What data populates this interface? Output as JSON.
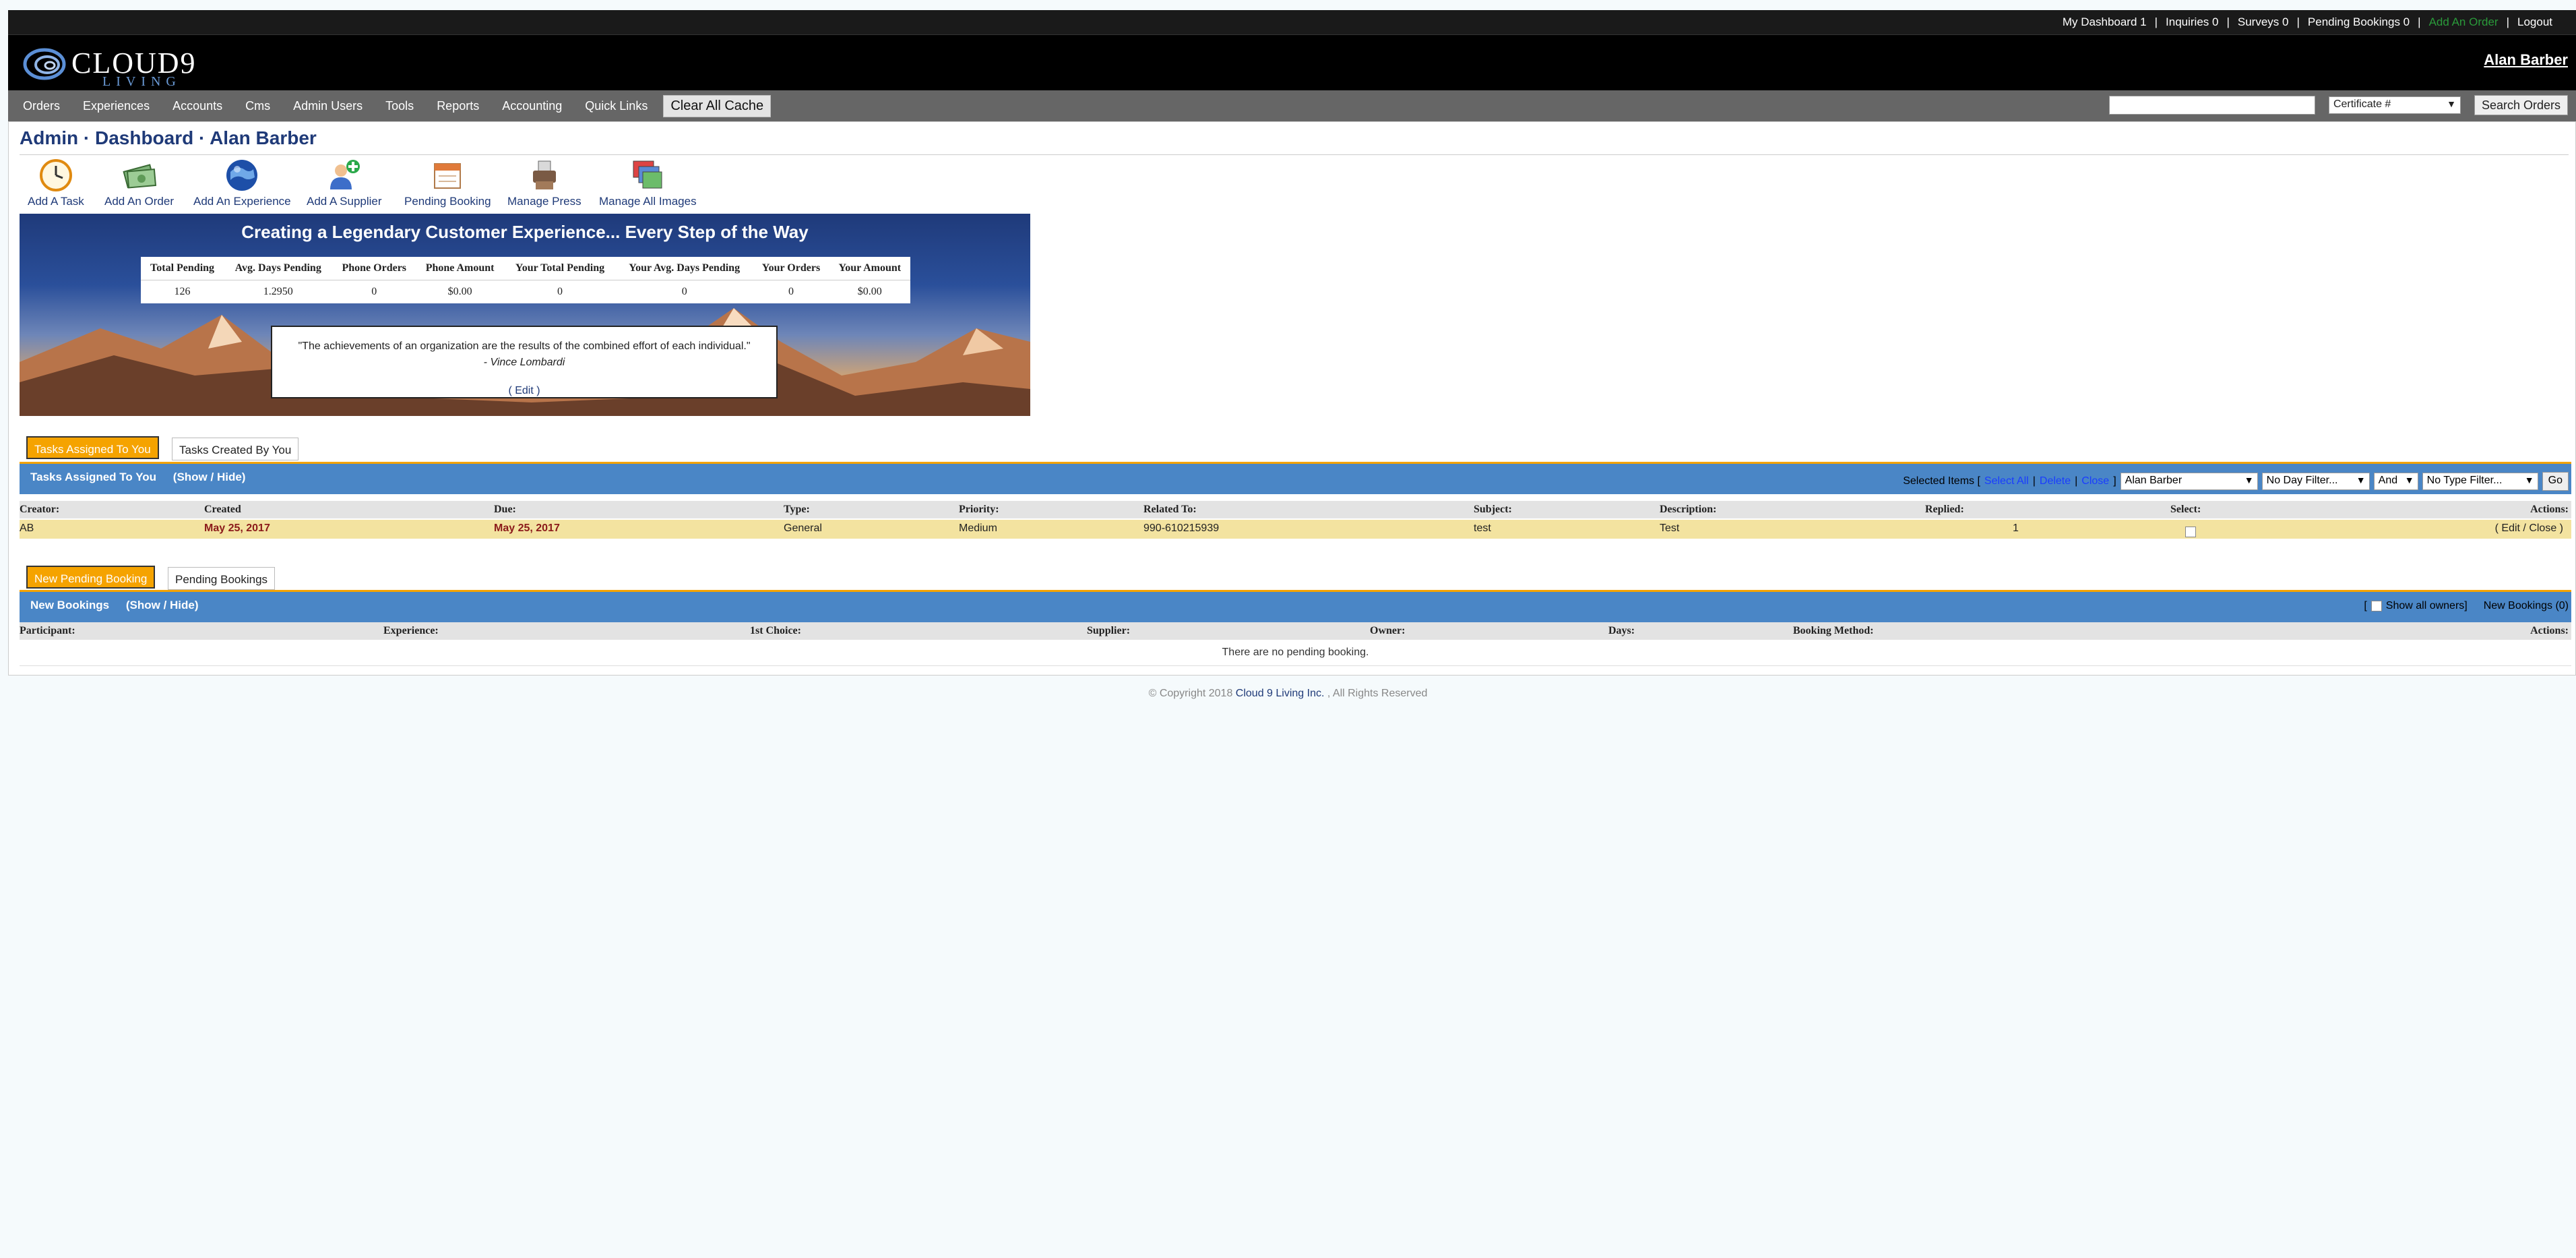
{
  "util_bar": {
    "links": [
      "My Dashboard 1",
      "Inquiries 0",
      "Surveys 0",
      "Pending Bookings 0",
      "Add An Order",
      "Logout"
    ],
    "accent_link_color": "#2a9a3a"
  },
  "header": {
    "logo_name": "CLOUD9",
    "logo_sub": "LIVING",
    "user": "Alan Barber"
  },
  "nav": {
    "items": [
      "Orders",
      "Experiences",
      "Accounts",
      "Cms",
      "Admin Users",
      "Tools",
      "Reports",
      "Accounting",
      "Quick Links"
    ],
    "cache_button": "Clear All Cache",
    "search_select": "Certificate #",
    "search_button": "Search Orders"
  },
  "page": {
    "title": "Admin · Dashboard · Alan Barber"
  },
  "quick_actions": [
    {
      "label": "Add A Task",
      "icon": "clock-icon"
    },
    {
      "label": "Add An Order",
      "icon": "money-icon"
    },
    {
      "label": "Add An Experience",
      "icon": "globe-icon"
    },
    {
      "label": "Add A Supplier",
      "icon": "add-user-icon"
    },
    {
      "label": "Pending Booking",
      "icon": "calendar-icon"
    },
    {
      "label": "Manage Press",
      "icon": "printer-icon"
    },
    {
      "label": "Manage All Images",
      "icon": "images-icon"
    }
  ],
  "banner": {
    "headline": "Creating a Legendary Customer Experience... Every Step of the Way",
    "stats_headers": [
      "Total Pending",
      "Avg. Days Pending",
      "Phone Orders",
      "Phone Amount",
      "Your Total Pending",
      "Your Avg. Days Pending",
      "Your Orders",
      "Your Amount"
    ],
    "stats_values": [
      "126",
      "1.2950",
      "0",
      "$0.00",
      "0",
      "0",
      "0",
      "$0.00"
    ],
    "quote": "\"The achievements of an organization are the results of the combined effort of each individual.\"",
    "quote_author": "- Vince Lombardi",
    "edit_link": "( Edit )"
  },
  "tasks": {
    "tab_assigned": "Tasks Assigned To You",
    "tab_created": "Tasks Created By You",
    "bar_title": "Tasks Assigned To You",
    "show_hide": "(Show / Hide)",
    "selected_items": "Selected Items [",
    "select_all": "Select All",
    "delete": "Delete",
    "close": "Close",
    "bracket_close": "]",
    "owner_filter": "Alan Barber",
    "day_filter": "No Day Filter...",
    "and_filter": "And",
    "type_filter": "No Type Filter...",
    "go": "Go",
    "columns": [
      "Creator:",
      "Created",
      "Due:",
      "Type:",
      "Priority:",
      "Related To:",
      "Subject:",
      "Description:",
      "Replied:",
      "Select:",
      "Actions:"
    ],
    "rows": [
      {
        "creator": "AB",
        "created": "May 25, 2017",
        "due": "May 25, 2017",
        "type": "General",
        "priority": "Medium",
        "related": "990-610215939",
        "subject": "test",
        "description": "Test",
        "replied": "1",
        "actions": "( Edit / Close )"
      }
    ]
  },
  "bookings": {
    "tab_new": "New Pending Booking",
    "tab_pending": "Pending Bookings",
    "bar_title": "New Bookings",
    "show_hide": "(Show / Hide)",
    "show_all_owners": "Show all owners]",
    "new_bookings_count": "New Bookings (0)",
    "columns": [
      "Participant:",
      "Experience:",
      "1st Choice:",
      "Supplier:",
      "Owner:",
      "Days:",
      "Booking Method:",
      "Actions:"
    ],
    "empty_message": "There are no pending booking."
  },
  "footer": {
    "prefix": "© Copyright 2018",
    "company": "Cloud 9 Living Inc.",
    "suffix": ", All Rights Reserved"
  }
}
